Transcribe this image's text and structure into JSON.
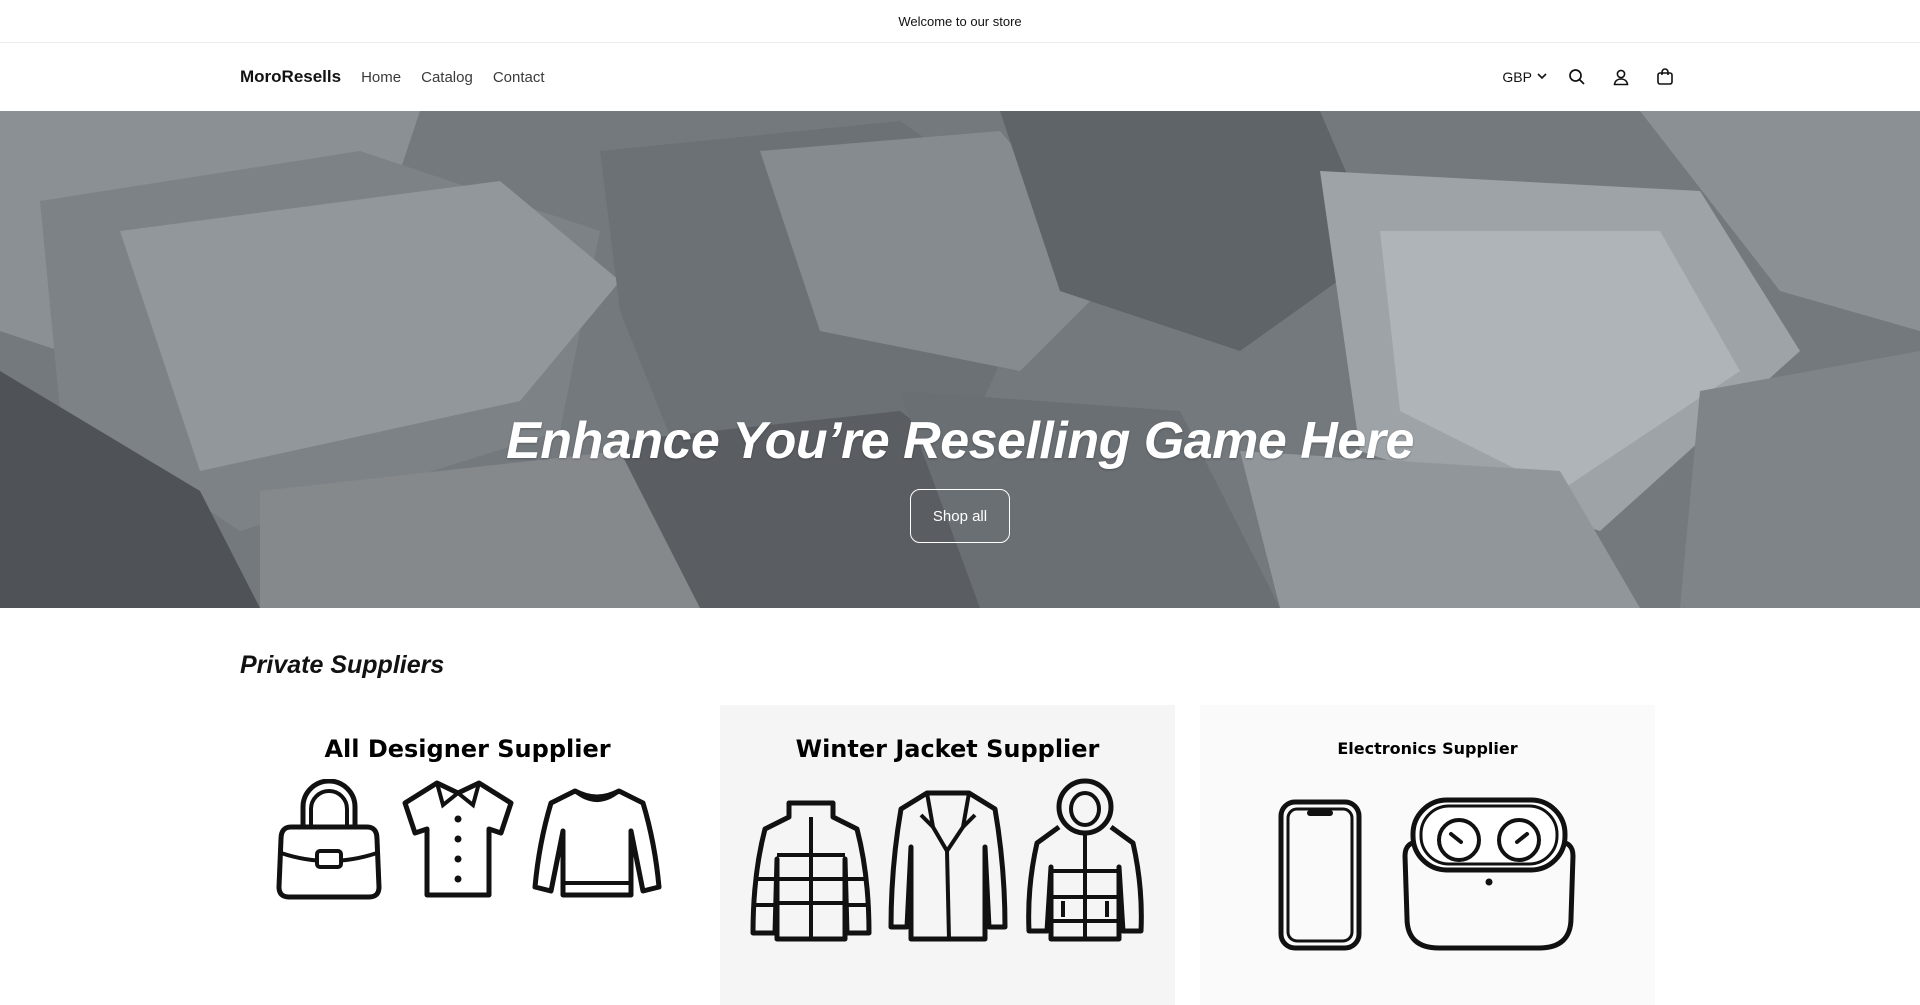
{
  "announcement": {
    "text": "Welcome to our store"
  },
  "header": {
    "logo": "MoroResells",
    "nav": [
      {
        "label": "Home"
      },
      {
        "label": "Catalog"
      },
      {
        "label": "Contact"
      }
    ],
    "currency": "GBP",
    "icons": [
      "search-icon",
      "account-icon",
      "cart-icon"
    ]
  },
  "hero": {
    "title": "Enhance You’re Reselling Game Here",
    "button_label": "Shop all"
  },
  "collections": {
    "title": "Private Suppliers",
    "cards": [
      {
        "title": "All Designer Supplier",
        "icons": [
          "handbag-icon",
          "polo-shirt-icon",
          "sweater-icon"
        ]
      },
      {
        "title": "Winter Jacket Supplier",
        "icons": [
          "puffer-jacket-icon",
          "coat-icon",
          "hooded-parka-icon"
        ]
      },
      {
        "title": "Electronics Supplier",
        "icons": [
          "smartphone-icon",
          "earbuds-case-icon"
        ]
      }
    ]
  }
}
